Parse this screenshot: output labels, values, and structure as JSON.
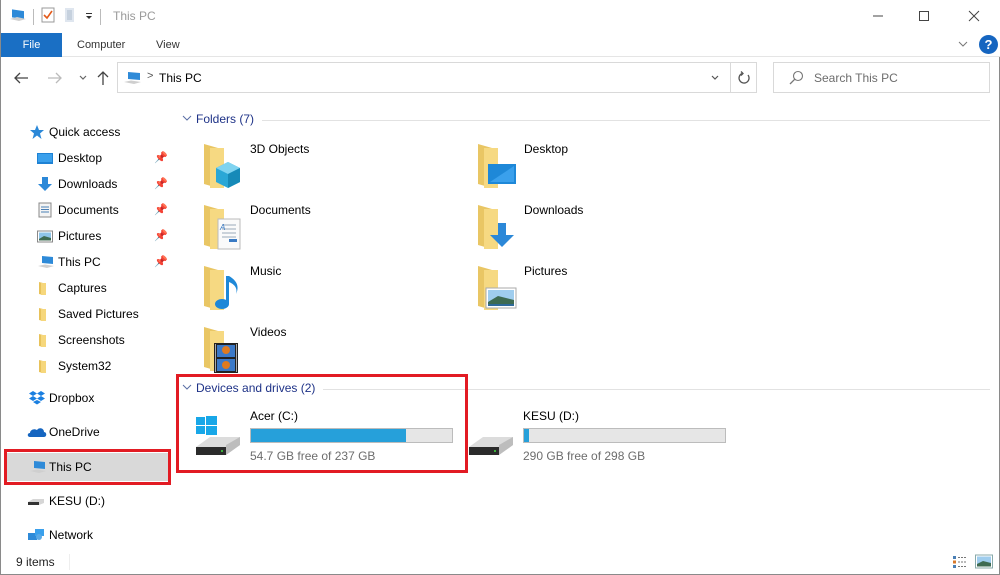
{
  "window": {
    "title": "This PC",
    "controls": {
      "minimize": "—",
      "maximize": "☐",
      "close": "✕"
    }
  },
  "quick_access_toolbar": {
    "icons": [
      "this-pc-icon",
      "properties-icon",
      "new-folder-icon",
      "customize-dropdown-icon"
    ]
  },
  "ribbon": {
    "tabs": [
      {
        "label": "File",
        "active": true
      },
      {
        "label": "Computer"
      },
      {
        "label": "View"
      }
    ],
    "help_label": "?"
  },
  "navigation": {
    "back": "←",
    "forward": "→",
    "recent": "⌄",
    "up": "↑",
    "address": {
      "breadcrumb": [
        "This PC"
      ],
      "separator": ">"
    },
    "refresh": "↻",
    "search": {
      "placeholder": "Search This PC",
      "value": ""
    }
  },
  "sidebar": {
    "quick_access": {
      "label": "Quick access"
    },
    "pinned": [
      {
        "label": "Desktop",
        "icon": "desktop-icon",
        "pinned": true
      },
      {
        "label": "Downloads",
        "icon": "downloads-icon",
        "pinned": true
      },
      {
        "label": "Documents",
        "icon": "documents-icon",
        "pinned": true
      },
      {
        "label": "Pictures",
        "icon": "pictures-icon",
        "pinned": true
      },
      {
        "label": "This PC",
        "icon": "this-pc-icon",
        "pinned": true
      },
      {
        "label": "Captures",
        "icon": "folder-icon"
      },
      {
        "label": "Saved Pictures",
        "icon": "folder-icon"
      },
      {
        "label": "Screenshots",
        "icon": "folder-icon"
      },
      {
        "label": "System32",
        "icon": "folder-icon"
      }
    ],
    "roots": [
      {
        "label": "Dropbox",
        "icon": "dropbox-icon"
      },
      {
        "label": "OneDrive",
        "icon": "onedrive-icon"
      },
      {
        "label": "This PC",
        "icon": "this-pc-icon",
        "selected": true
      },
      {
        "label": "KESU (D:)",
        "icon": "drive-icon"
      },
      {
        "label": "Network",
        "icon": "network-icon"
      }
    ]
  },
  "content": {
    "folders_group": {
      "title": "Folders (7)"
    },
    "folders": [
      {
        "name": "3D Objects",
        "icon": "3d-objects-folder-icon"
      },
      {
        "name": "Desktop",
        "icon": "desktop-folder-icon"
      },
      {
        "name": "Documents",
        "icon": "documents-folder-icon"
      },
      {
        "name": "Downloads",
        "icon": "downloads-folder-icon"
      },
      {
        "name": "Music",
        "icon": "music-folder-icon"
      },
      {
        "name": "Pictures",
        "icon": "pictures-folder-icon"
      },
      {
        "name": "Videos",
        "icon": "videos-folder-icon"
      }
    ],
    "drives_group": {
      "title": "Devices and drives (2)"
    },
    "drives": [
      {
        "name": "Acer (C:)",
        "free_text": "54.7 GB free of 237 GB",
        "free_gb": 54.7,
        "total_gb": 237,
        "used_fraction": 0.769,
        "icon": "windows-drive-icon"
      },
      {
        "name": "KESU (D:)",
        "free_text": "290 GB free of 298 GB",
        "free_gb": 290,
        "total_gb": 298,
        "used_fraction": 0.027,
        "icon": "drive-icon"
      }
    ]
  },
  "statusbar": {
    "item_count": "9 items",
    "views": [
      "details-view-icon",
      "large-icons-view-icon"
    ]
  },
  "colors": {
    "accent": "#1a6fc4",
    "highlight_box": "#e21b23",
    "progress_fill": "#26a0da",
    "group_title": "#1e3287",
    "selected_bg": "#d9d9d9"
  }
}
